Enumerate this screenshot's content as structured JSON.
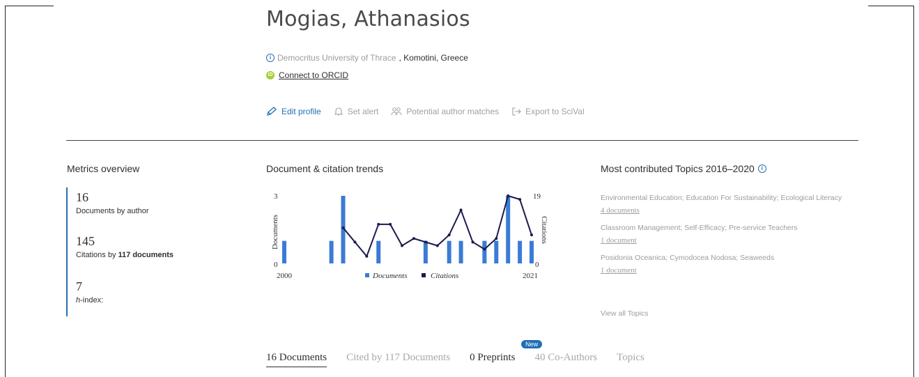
{
  "author": {
    "name": "Mogias, Athanasios",
    "university": "Democritus University of Thrace",
    "location": ", Komotini, Greece",
    "orcid_link": "Connect to ORCID"
  },
  "actions": {
    "edit": "Edit profile",
    "alert": "Set alert",
    "matches": "Potential author matches",
    "export": "Export to SciVal"
  },
  "metrics": {
    "title": "Metrics overview",
    "documents_value": "16",
    "documents_label": "Documents by author",
    "citations_value": "145",
    "citations_label_prefix": "Citations by ",
    "citations_label_bold": "117 documents",
    "hindex_value": "7",
    "hindex_label_italic": "h",
    "hindex_label_rest": "-index:"
  },
  "trend": {
    "title": "Document & citation trends"
  },
  "chart_data": {
    "type": "bar",
    "x": [
      2000,
      2001,
      2002,
      2003,
      2004,
      2005,
      2006,
      2007,
      2008,
      2009,
      2010,
      2011,
      2012,
      2013,
      2014,
      2015,
      2016,
      2017,
      2018,
      2019,
      2020,
      2021
    ],
    "series": [
      {
        "name": "Documents",
        "values": [
          1,
          0,
          0,
          0,
          1,
          3,
          0,
          0,
          1,
          0,
          0,
          0,
          1,
          0,
          1,
          1,
          0,
          1,
          1,
          3,
          1,
          1
        ]
      },
      {
        "name": "Citations",
        "values": [
          null,
          null,
          null,
          null,
          null,
          10,
          6,
          2,
          11,
          11,
          5,
          7,
          6,
          5,
          8,
          15,
          6,
          4,
          7,
          19,
          18,
          8
        ]
      }
    ],
    "y_left_ticks": [
      "0",
      "3"
    ],
    "y_right_ticks": [
      "0",
      "19"
    ],
    "x_tick_labels": [
      "2000",
      "2021"
    ],
    "ylabel": "Documents",
    "y2label": "Citations",
    "ylim": [
      0,
      3
    ],
    "y2lim": [
      0,
      19
    ],
    "colors": {
      "Documents": "#3a7bd5",
      "Citations": "#1a1a4e"
    },
    "legend": "bottom"
  },
  "topics": {
    "title": "Most contributed Topics 2016–2020",
    "items": [
      {
        "name": "Environmental Education; Education For Sustainability; Ecological Literacy",
        "count": "4 documents"
      },
      {
        "name": "Classroom Management; Self-Efficacy; Pre-service Teachers",
        "count": "1 document"
      },
      {
        "name": "Posidonia Oceanica; Cymodocea Nodosa; Seaweeds",
        "count": "1 document"
      }
    ],
    "view_all": "View all Topics"
  },
  "tabs": {
    "documents": "16 Documents",
    "cited_by": "Cited by 117 Documents",
    "preprints": "0 Preprints",
    "preprints_badge": "New",
    "coauthors": "40 Co-Authors",
    "topics": "Topics"
  }
}
